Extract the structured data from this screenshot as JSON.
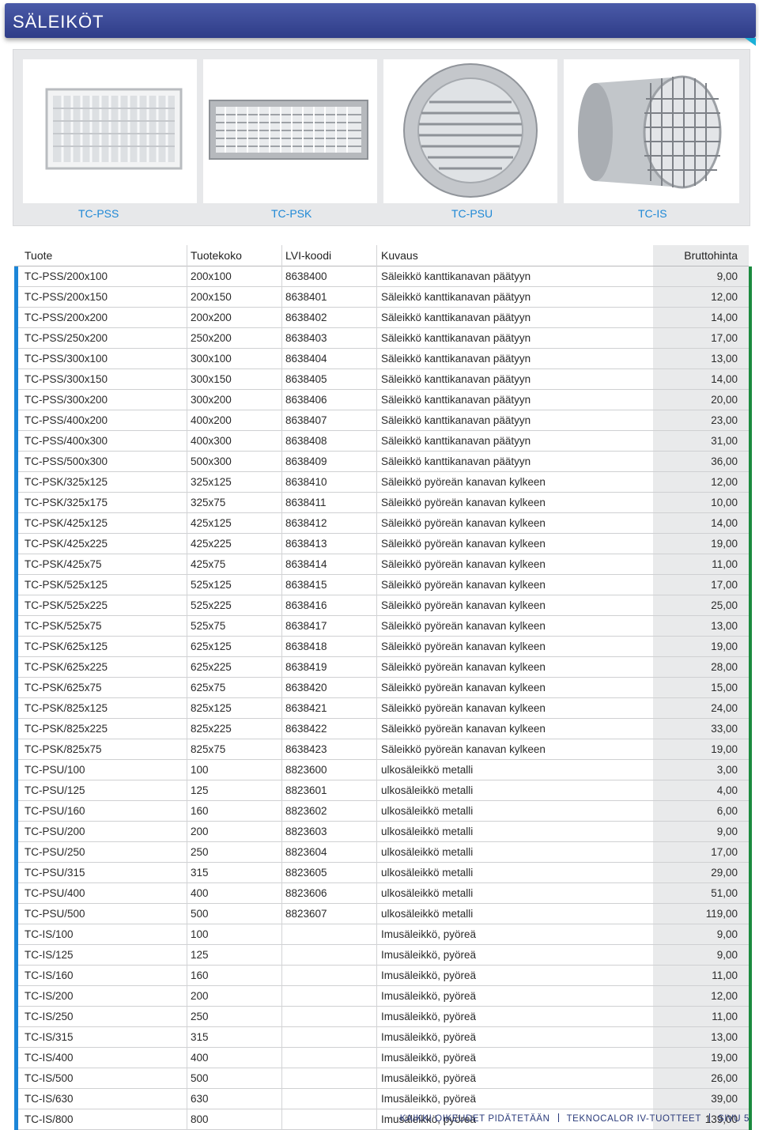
{
  "header": {
    "title": "SÄLEIKÖT"
  },
  "products": [
    {
      "label": "TC-PSS",
      "image": "rectangular-double-grille"
    },
    {
      "label": "TC-PSK",
      "image": "rectangular-duct-grille"
    },
    {
      "label": "TC-PSU",
      "image": "round-louvre-grille"
    },
    {
      "label": "TC-IS",
      "image": "round-intake-mesh"
    }
  ],
  "table": {
    "headers": [
      "Tuote",
      "Tuotekoko",
      "LVI-koodi",
      "Kuvaus",
      "Bruttohinta"
    ],
    "rows": [
      [
        "TC-PSS/200x100",
        "200x100",
        "8638400",
        "Säleikkö kanttikanavan päätyyn",
        "9,00"
      ],
      [
        "TC-PSS/200x150",
        "200x150",
        "8638401",
        "Säleikkö kanttikanavan päätyyn",
        "12,00"
      ],
      [
        "TC-PSS/200x200",
        "200x200",
        "8638402",
        "Säleikkö kanttikanavan päätyyn",
        "14,00"
      ],
      [
        "TC-PSS/250x200",
        "250x200",
        "8638403",
        "Säleikkö kanttikanavan päätyyn",
        "17,00"
      ],
      [
        "TC-PSS/300x100",
        "300x100",
        "8638404",
        "Säleikkö kanttikanavan päätyyn",
        "13,00"
      ],
      [
        "TC-PSS/300x150",
        "300x150",
        "8638405",
        "Säleikkö kanttikanavan päätyyn",
        "14,00"
      ],
      [
        "TC-PSS/300x200",
        "300x200",
        "8638406",
        "Säleikkö kanttikanavan päätyyn",
        "20,00"
      ],
      [
        "TC-PSS/400x200",
        "400x200",
        "8638407",
        "Säleikkö kanttikanavan päätyyn",
        "23,00"
      ],
      [
        "TC-PSS/400x300",
        "400x300",
        "8638408",
        "Säleikkö kanttikanavan päätyyn",
        "31,00"
      ],
      [
        "TC-PSS/500x300",
        "500x300",
        "8638409",
        "Säleikkö kanttikanavan päätyyn",
        "36,00"
      ],
      [
        "TC-PSK/325x125",
        "325x125",
        "8638410",
        "Säleikkö pyöreän kanavan kylkeen",
        "12,00"
      ],
      [
        "TC-PSK/325x175",
        "325x75",
        "8638411",
        "Säleikkö pyöreän kanavan kylkeen",
        "10,00"
      ],
      [
        "TC-PSK/425x125",
        "425x125",
        "8638412",
        "Säleikkö pyöreän kanavan kylkeen",
        "14,00"
      ],
      [
        "TC-PSK/425x225",
        "425x225",
        "8638413",
        "Säleikkö pyöreän kanavan kylkeen",
        "19,00"
      ],
      [
        "TC-PSK/425x75",
        "425x75",
        "8638414",
        "Säleikkö pyöreän kanavan kylkeen",
        "11,00"
      ],
      [
        "TC-PSK/525x125",
        "525x125",
        "8638415",
        "Säleikkö pyöreän kanavan kylkeen",
        "17,00"
      ],
      [
        "TC-PSK/525x225",
        "525x225",
        "8638416",
        "Säleikkö pyöreän kanavan kylkeen",
        "25,00"
      ],
      [
        "TC-PSK/525x75",
        "525x75",
        "8638417",
        "Säleikkö pyöreän kanavan kylkeen",
        "13,00"
      ],
      [
        "TC-PSK/625x125",
        "625x125",
        "8638418",
        "Säleikkö pyöreän kanavan kylkeen",
        "19,00"
      ],
      [
        "TC-PSK/625x225",
        "625x225",
        "8638419",
        "Säleikkö pyöreän kanavan kylkeen",
        "28,00"
      ],
      [
        "TC-PSK/625x75",
        "625x75",
        "8638420",
        "Säleikkö pyöreän kanavan kylkeen",
        "15,00"
      ],
      [
        "TC-PSK/825x125",
        "825x125",
        "8638421",
        "Säleikkö pyöreän kanavan kylkeen",
        "24,00"
      ],
      [
        "TC-PSK/825x225",
        "825x225",
        "8638422",
        "Säleikkö pyöreän kanavan kylkeen",
        "33,00"
      ],
      [
        "TC-PSK/825x75",
        "825x75",
        "8638423",
        "Säleikkö pyöreän kanavan kylkeen",
        "19,00"
      ],
      [
        "TC-PSU/100",
        "100",
        "8823600",
        "ulkosäleikkö metalli",
        "3,00"
      ],
      [
        "TC-PSU/125",
        "125",
        "8823601",
        "ulkosäleikkö metalli",
        "4,00"
      ],
      [
        "TC-PSU/160",
        "160",
        "8823602",
        "ulkosäleikkö metalli",
        "6,00"
      ],
      [
        "TC-PSU/200",
        "200",
        "8823603",
        "ulkosäleikkö metalli",
        "9,00"
      ],
      [
        "TC-PSU/250",
        "250",
        "8823604",
        "ulkosäleikkö metalli",
        "17,00"
      ],
      [
        "TC-PSU/315",
        "315",
        "8823605",
        "ulkosäleikkö metalli",
        "29,00"
      ],
      [
        "TC-PSU/400",
        "400",
        "8823606",
        "ulkosäleikkö metalli",
        "51,00"
      ],
      [
        "TC-PSU/500",
        "500",
        "8823607",
        "ulkosäleikkö metalli",
        "119,00"
      ],
      [
        "TC-IS/100",
        "100",
        "",
        "Imusäleikkö, pyöreä",
        "9,00"
      ],
      [
        "TC-IS/125",
        "125",
        "",
        "Imusäleikkö, pyöreä",
        "9,00"
      ],
      [
        "TC-IS/160",
        "160",
        "",
        "Imusäleikkö, pyöreä",
        "11,00"
      ],
      [
        "TC-IS/200",
        "200",
        "",
        "Imusäleikkö, pyöreä",
        "12,00"
      ],
      [
        "TC-IS/250",
        "250",
        "",
        "Imusäleikkö, pyöreä",
        "11,00"
      ],
      [
        "TC-IS/315",
        "315",
        "",
        "Imusäleikkö, pyöreä",
        "13,00"
      ],
      [
        "TC-IS/400",
        "400",
        "",
        "Imusäleikkö, pyöreä",
        "19,00"
      ],
      [
        "TC-IS/500",
        "500",
        "",
        "Imusäleikkö, pyöreä",
        "26,00"
      ],
      [
        "TC-IS/630",
        "630",
        "",
        "Imusäleikkö, pyöreä",
        "39,00"
      ],
      [
        "TC-IS/800",
        "800",
        "",
        "Imusäleikkö, pyöreä",
        "139,00"
      ]
    ]
  },
  "footer": {
    "rights": "KAIKKI OIKEUDET PIDÄTETÄÄN",
    "brand": "TEKNOCALOR IV-TUOTTEET",
    "page": "SIVU 5"
  },
  "colors": {
    "banner": "#3a4a98",
    "accent": "#1c86d8",
    "price_marker": "#1b8a3f",
    "label": "#1e88d6"
  }
}
